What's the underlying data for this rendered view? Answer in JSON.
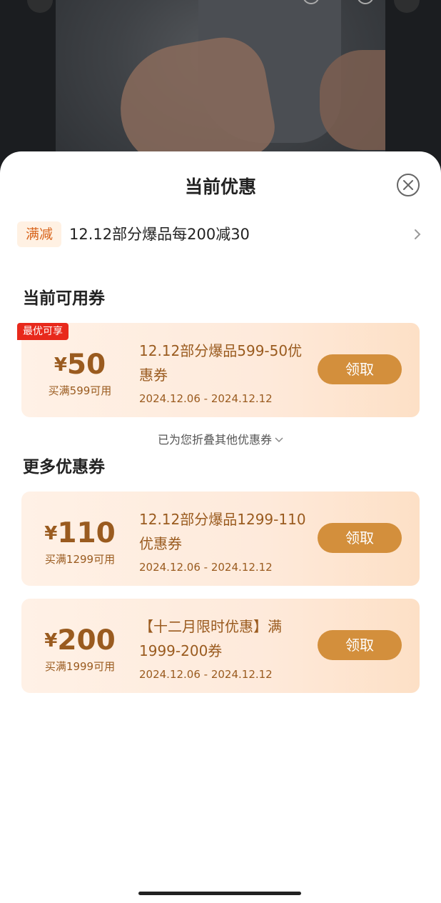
{
  "sheet": {
    "title": "当前优惠",
    "close_icon": "close-circle-icon"
  },
  "promo": {
    "tag": "满减",
    "text": "12.12部分爆品每200减30",
    "chevron_icon": "chevron-right-icon"
  },
  "sections": {
    "available_title": "当前可用券",
    "more_title": "更多优惠券"
  },
  "fold_note": "已为您折叠其他优惠券",
  "coupons": [
    {
      "badge": "最优可享",
      "currency": "¥",
      "amount": "50",
      "condition": "买满599可用",
      "name": "12.12部分爆品599-50优惠券",
      "date": "2024.12.06 - 2024.12.12",
      "button": "领取"
    },
    {
      "currency": "¥",
      "amount": "110",
      "condition": "买满1299可用",
      "name": "12.12部分爆品1299-110优惠券",
      "date": "2024.12.06 - 2024.12.12",
      "button": "领取"
    },
    {
      "currency": "¥",
      "amount": "200",
      "condition": "买满1999可用",
      "name": "【十二月限时优惠】满1999-200券",
      "date": "2024.12.06 - 2024.12.12",
      "button": "领取"
    }
  ],
  "colors": {
    "accent_text": "#9a5b1f",
    "button_bg": "#d38f3c",
    "badge_bg": "#e8291c",
    "tag_text": "#d8651d"
  }
}
